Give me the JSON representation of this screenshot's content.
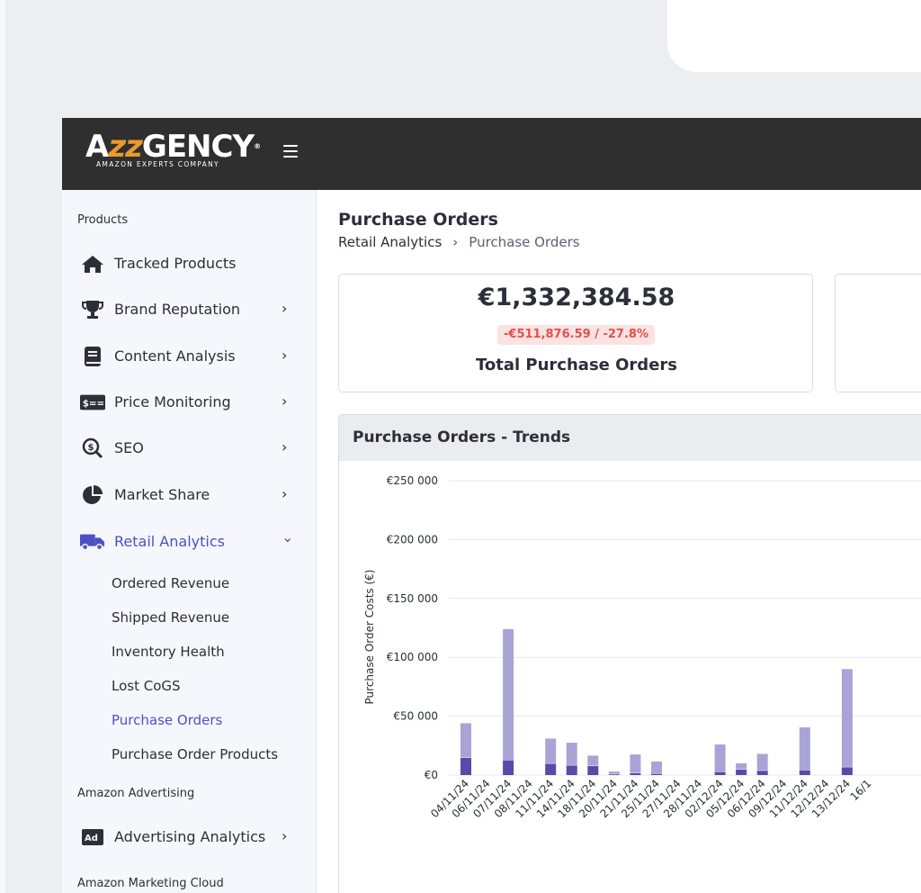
{
  "logo": {
    "word_a": "A",
    "word_zz": "zz",
    "word_b": "GENCY",
    "registered": "®",
    "tagline": "AMAZON EXPERTS COMPANY"
  },
  "sidebar": {
    "section_products": "Products",
    "items": [
      {
        "label": "Tracked Products",
        "icon": "home-icon",
        "chevron": ""
      },
      {
        "label": "Brand Reputation",
        "icon": "trophy-icon",
        "chevron": "›"
      },
      {
        "label": "Content Analysis",
        "icon": "book-icon",
        "chevron": "›"
      },
      {
        "label": "Price Monitoring",
        "icon": "price-tag-icon",
        "chevron": "›"
      },
      {
        "label": "SEO",
        "icon": "seo-search-icon",
        "chevron": "›"
      },
      {
        "label": "Market Share",
        "icon": "pie-chart-icon",
        "chevron": "›"
      },
      {
        "label": "Retail Analytics",
        "icon": "truck-icon",
        "chevron": "⌄"
      }
    ],
    "retail_sub": [
      "Ordered Revenue",
      "Shipped Revenue",
      "Inventory Health",
      "Lost CoGS",
      "Purchase Orders",
      "Purchase Order Products"
    ],
    "section_advertising": "Amazon Advertising",
    "advertising_item": {
      "label": "Advertising Analytics",
      "icon": "ad-badge-icon",
      "chevron": "›",
      "badge": "Ad"
    },
    "section_amc": "Amazon Marketing Cloud",
    "price_badge": "$=="
  },
  "main": {
    "title": "Purchase Orders",
    "breadcrumb": {
      "parent": "Retail Analytics",
      "sep": "›",
      "current": "Purchase Orders"
    },
    "kpi": {
      "value": "€1,332,384.58",
      "delta": "-€511,876.59 / -27.8%",
      "label": "Total Purchase Orders"
    },
    "chart_title": "Purchase Orders - Trends"
  },
  "colors": {
    "accent": "#4f4fc4",
    "bar_light": "#a9a4d6",
    "bar_dark": "#5a49a8",
    "delta_bg": "#fde2e2",
    "delta_text": "#e2504c"
  },
  "chart_data": {
    "type": "bar",
    "stacked": true,
    "ylabel": "Purchase Order Costs (€)",
    "ylim": [
      0,
      250000
    ],
    "yticks": [
      "€0",
      "€50 000",
      "€100 000",
      "€150 000",
      "€200 000",
      "€250 000"
    ],
    "categories": [
      "04/11/24",
      "06/11/24",
      "07/11/24",
      "08/11/24",
      "11/11/24",
      "14/11/24",
      "18/11/24",
      "20/11/24",
      "21/11/24",
      "25/11/24",
      "27/11/24",
      "28/11/24",
      "02/12/24",
      "05/12/24",
      "06/12/24",
      "09/12/24",
      "11/12/24",
      "12/12/24",
      "13/12/24",
      "16/1"
    ],
    "series": [
      {
        "values": [
          15000,
          0,
          13000,
          0,
          10000,
          8500,
          8000,
          1000,
          2000,
          1500,
          0,
          0,
          3000,
          5000,
          4000,
          0,
          4500,
          0,
          7000,
          0
        ]
      },
      {
        "values": [
          29000,
          0,
          111000,
          0,
          21000,
          19000,
          8500,
          2000,
          15500,
          10000,
          0,
          0,
          23000,
          5000,
          14000,
          0,
          36000,
          0,
          83000,
          0
        ]
      }
    ],
    "grid": true
  }
}
